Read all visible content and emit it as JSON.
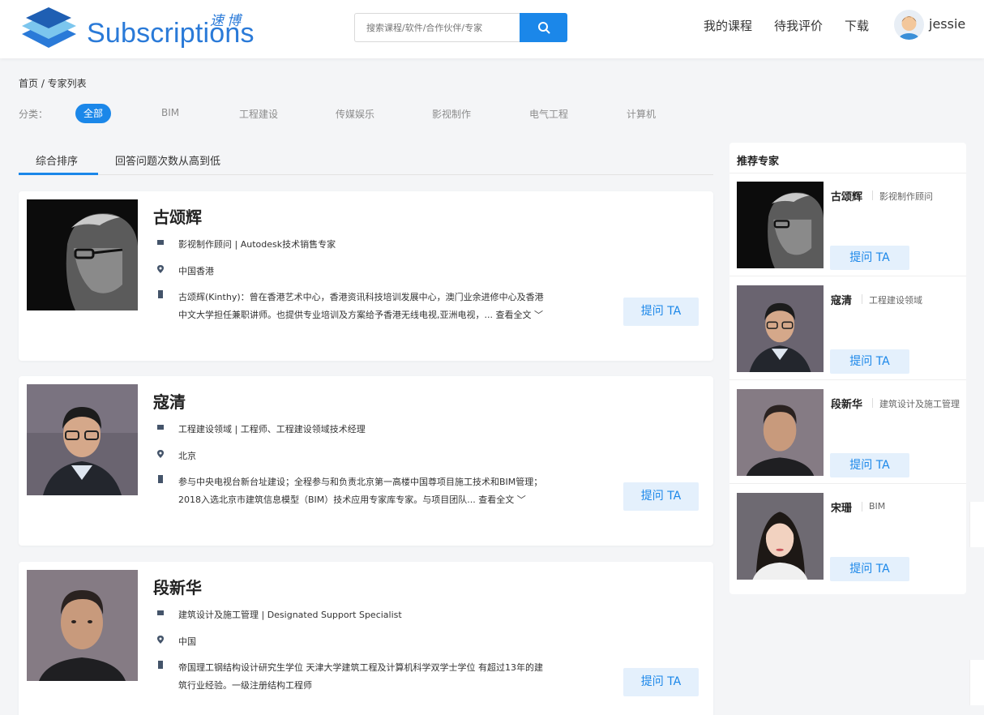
{
  "header": {
    "logo_text": "Subscriptions",
    "logo_cn": "速博",
    "search_placeholder": "搜索课程/软件/合作伙伴/专家",
    "nav": [
      "我的课程",
      "待我评价",
      "下载"
    ],
    "username": "jessie"
  },
  "breadcrumb": "首页 / 专家列表",
  "categories": {
    "label": "分类：",
    "active": "全部",
    "items": [
      "BIM",
      "工程建设",
      "传媒娱乐",
      "影视制作",
      "电气工程",
      "计算机"
    ]
  },
  "sort_tabs": [
    "综合排序",
    "回答问题次数从高到低"
  ],
  "experts": [
    {
      "name": "古颂辉",
      "title": "影视制作顾问 | Autodesk技术销售专家",
      "location": "中国香港",
      "bio": "古颂辉(Kinthy)：曾在香港艺术中心，香港资讯科技培训发展中心，澳门业余进修中心及香港中文大学担任兼职讲师。也提供专业培训及方案给予香港无线电视,亚洲电视，... 查看全文 ﹀",
      "ask": "提问 TA"
    },
    {
      "name": "寇清",
      "title": "工程建设领域 | 工程师、工程建设领域技术经理",
      "location": "北京",
      "bio": "参与中央电视台新台址建设；全程参与和负责北京第一高楼中国尊项目施工技术和BIM管理；2018入选北京市建筑信息模型（BIM）技术应用专家库专家。与项目团队... 查看全文 ﹀",
      "ask": "提问 TA"
    },
    {
      "name": "段新华",
      "title": "建筑设计及施工管理 | Designated Support Specialist",
      "location": "中国",
      "bio": "帝国理工钢结构设计研究生学位 天津大学建筑工程及计算机科学双学士学位 有超过13年的建筑行业经验。一级注册结构工程师",
      "ask": "提问 TA"
    }
  ],
  "sidebar": {
    "title": "推荐专家",
    "items": [
      {
        "name": "古颂辉",
        "title": "影视制作顾问",
        "ask": "提问 TA"
      },
      {
        "name": "寇清",
        "title": "工程建设领域",
        "ask": "提问 TA"
      },
      {
        "name": "段新华",
        "title": "建筑设计及施工管理",
        "ask": "提问 TA"
      },
      {
        "name": "宋珊",
        "title": "BIM",
        "ask": "提问 TA"
      }
    ]
  },
  "colors": {
    "accent": "#1b87e9",
    "ask_bg": "#e4f0fc",
    "page_bg": "#f4f5f7"
  }
}
